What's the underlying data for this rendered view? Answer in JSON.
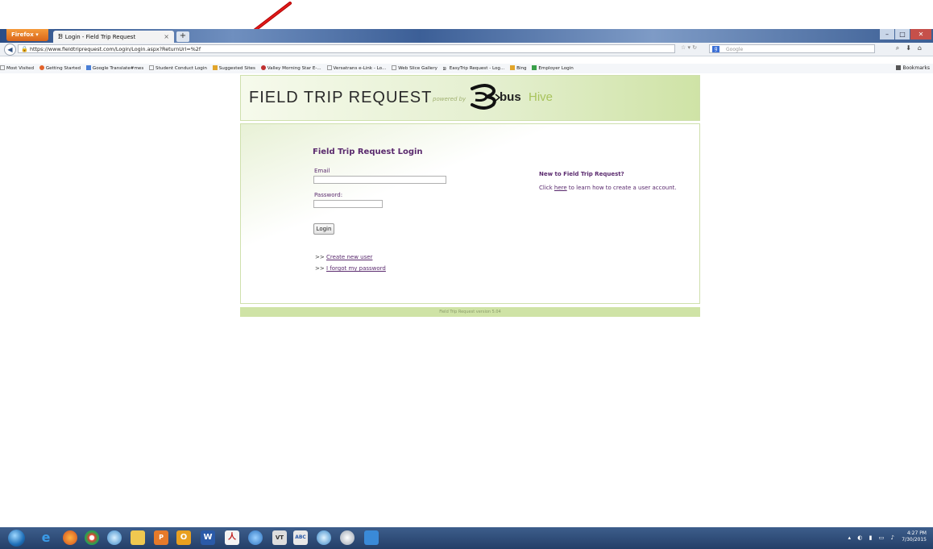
{
  "browser": {
    "menu_button": "Firefox ▾",
    "tab_title": "Login - Field Trip Request",
    "new_tab": "+",
    "url": "https://www.fieldtriprequest.com/Login/Login.aspx?ReturnUrl=%2f",
    "search_placeholder": "Google",
    "bookmarks": [
      "Most Visited",
      "Getting Started",
      "Google Translate#mes",
      "Student Conduct Login",
      "Suggested Sites",
      "Valley Morning Star E-...",
      "Versatrans e-Link - Lo...",
      "Web Slice Gallery",
      "EasyTrip Request - Log...",
      "Bing",
      "Employer Login"
    ],
    "bookmarks_menu": "Bookmarks"
  },
  "page": {
    "banner_title": "FIELD TRIP REQUEST",
    "powered_by": "powered by",
    "brand_bus": "bus",
    "brand_hive": "Hive",
    "login_title": "Field Trip Request Login",
    "email_label": "Email",
    "password_label": "Password:",
    "login_button": "Login",
    "prefix": ">>",
    "create_user_link": "Create new user",
    "forgot_password_link": "I forgot my password",
    "new_title": "New to Field Trip Request?",
    "new_text_pre": "Click ",
    "new_text_link": "here",
    "new_text_post": " to learn how to create a user account.",
    "footer": "Field Trip Request version 5.04"
  },
  "taskbar": {
    "time": "4:27 PM",
    "date": "7/30/2015"
  }
}
